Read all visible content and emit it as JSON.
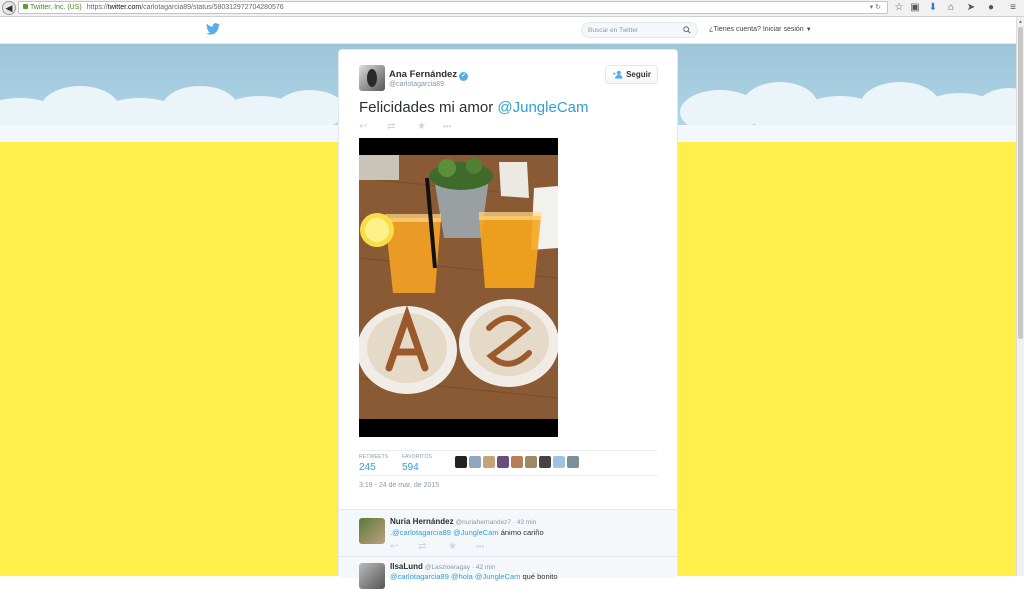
{
  "browser": {
    "site_identity": "Twitter, Inc. (US)",
    "url_prefix": "https://",
    "url_host": "twitter.com",
    "url_path": "/carlotagarcia89/status/580312972704280576",
    "toolbar_icons": [
      "star-icon",
      "clipboard-icon",
      "download-icon",
      "home-icon",
      "send-icon",
      "chat-icon",
      "menu-icon"
    ]
  },
  "topbar": {
    "search_placeholder": "Buscar en Twitter",
    "login_prompt": "¿Tienes cuenta? Iniciar sesión"
  },
  "tweet": {
    "author_name": "Ana Fernández",
    "author_handle": "@carlotagarcia89",
    "follow_label": "Seguir",
    "text": "Felicidades mi amor ",
    "mention": "@JungleCam",
    "retweets_label": "RETWEETS",
    "retweets_count": "245",
    "favorites_label": "FAVORITOS",
    "favorites_count": "594",
    "timestamp": "3:19 - 24 de mar. de 2015",
    "colors": {
      "link": "#2e9ed8",
      "background_yellow": "#ffef4a",
      "sky": "#a9d0e3"
    }
  },
  "replies": [
    {
      "name": "Nuria Hernández",
      "handle": "@nuriahernandez7 · 43 min",
      "mention1": ".@carlotagarcia89 ",
      "mention2": "@JungleCam",
      "text": " ánimo cariño"
    },
    {
      "name": "IlsaLund",
      "handle": "@Laszloeragay · 42 min",
      "mention1": "@carlotagarcia89 ",
      "mention2": "@hola @JungleCam",
      "text": " qué bonito"
    }
  ]
}
